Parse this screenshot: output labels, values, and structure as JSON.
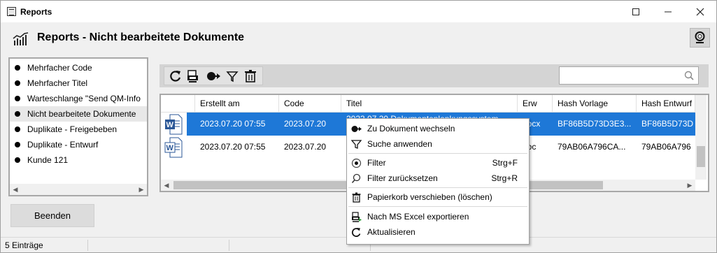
{
  "window": {
    "title": "Reports",
    "controls": [
      "minimize",
      "maximize",
      "close"
    ]
  },
  "header": {
    "title": "Reports - Nicht bearbeitete Dokumente",
    "icon": "chart-icon",
    "help_icon": "lifebuoy-icon"
  },
  "sidebar": {
    "items": [
      {
        "label": "Mehrfacher Code"
      },
      {
        "label": "Mehrfacher Titel"
      },
      {
        "label": "Warteschlange \"Send QM-Info"
      },
      {
        "label": "Nicht bearbeitete Dokumente",
        "selected": true
      },
      {
        "label": "Duplikate - Freigebeben"
      },
      {
        "label": "Duplikate - Entwurf"
      },
      {
        "label": "Kunde 121"
      }
    ]
  },
  "buttons": {
    "beenden": "Beenden"
  },
  "toolbar": {
    "icons": [
      "refresh-icon",
      "excel-export-icon",
      "goto-document-icon",
      "filter-icon",
      "trash-icon"
    ],
    "search": {
      "value": "",
      "placeholder": ""
    }
  },
  "grid": {
    "columns": [
      "Erstellt am",
      "Code",
      "Titel",
      "Erw",
      "Hash Vorlage",
      "Hash Entwurf"
    ],
    "rows": [
      {
        "icon": "word-document-icon",
        "erstellt_am": "2023.07.20 07:55",
        "code": "2023.07.20",
        "titel": "2023.07.20 Dokumentenlenkungssystem",
        "erw": "docx",
        "hash_vorlage": "BF86B5D73D3E3...",
        "hash_entwurf": "BF86B5D73D",
        "selected": true
      },
      {
        "icon": "word-document-icon",
        "erstellt_am": "2023.07.20 07:55",
        "code": "2023.07.20",
        "titel": "",
        "erw": "doc",
        "hash_vorlage": "79AB06A796CA...",
        "hash_entwurf": "79AB06A796",
        "selected": false
      }
    ]
  },
  "context_menu": {
    "items": [
      {
        "label": "Zu Dokument wechseln",
        "accel": "Z",
        "shortcut": "",
        "icon": "goto-document-icon"
      },
      {
        "label": "Suche anwenden",
        "accel": "S",
        "shortcut": "",
        "icon": "filter-outline-icon"
      },
      {
        "label": "Filter",
        "accel": "F",
        "shortcut": "Strg+F",
        "icon": "filter-target-icon"
      },
      {
        "label": "Filter zurücksetzen",
        "accel": "F",
        "shortcut": "Strg+R",
        "icon": "search-reset-icon"
      },
      {
        "label": "Papierkorb verschieben (löschen)",
        "accel": "P",
        "shortcut": "",
        "icon": "trash-icon"
      },
      {
        "label": "Nach MS Excel exportieren",
        "accel": "N",
        "shortcut": "",
        "icon": "excel-export-icon"
      },
      {
        "label": "Aktualisieren",
        "accel": "A",
        "shortcut": "",
        "icon": "refresh-icon"
      }
    ]
  },
  "status": {
    "count": "5 Einträge"
  },
  "colors": {
    "selection": "#1e78d7",
    "toolbar_bg": "#d4d4d4",
    "window_bg": "#f0f0f0",
    "word_blue": "#2b5797"
  }
}
